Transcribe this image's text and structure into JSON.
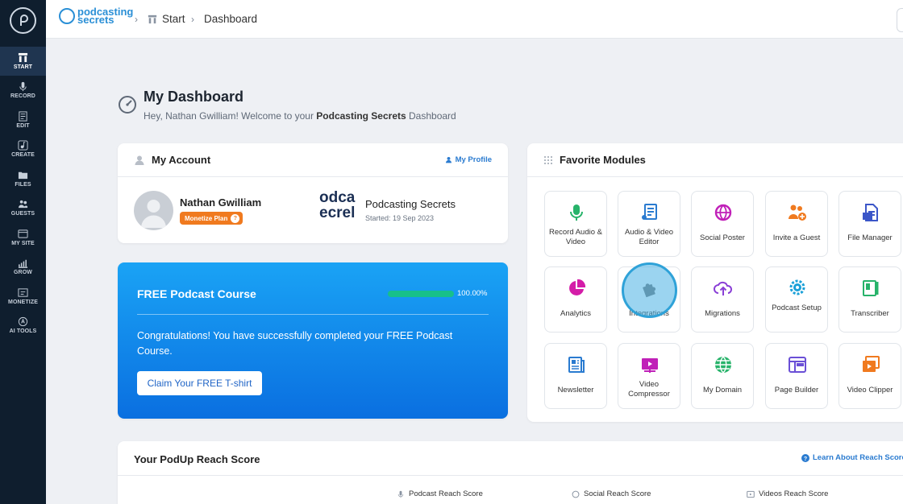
{
  "sidebar": {
    "items": [
      {
        "label": "START",
        "icon": "start-icon",
        "active": true
      },
      {
        "label": "RECORD",
        "icon": "microphone-icon"
      },
      {
        "label": "EDIT",
        "icon": "edit-icon"
      },
      {
        "label": "CREATE",
        "icon": "music-note-icon"
      },
      {
        "label": "FILES",
        "icon": "files-icon"
      },
      {
        "label": "GUESTS",
        "icon": "guests-icon"
      },
      {
        "label": "MY SITE",
        "icon": "site-icon"
      },
      {
        "label": "GROW",
        "icon": "chart-icon"
      },
      {
        "label": "MONETIZE",
        "icon": "monetize-icon"
      },
      {
        "label": "AI TOOLS",
        "icon": "ai-icon"
      }
    ]
  },
  "topbar": {
    "brand_line1": "podcasting",
    "brand_line2": "secrets",
    "breadcrumb_start": "Start",
    "breadcrumb_current": "Dashboard"
  },
  "header": {
    "title": "My Dashboard",
    "greeting_prefix": "Hey, Nathan Gwilliam! Welcome to your ",
    "greeting_brand": "Podcasting Secrets",
    "greeting_suffix": " Dashboard"
  },
  "account": {
    "title": "My Account",
    "profile_link": "My Profile",
    "name": "Nathan Gwilliam",
    "plan": "Monetize Plan",
    "plan_help": "?",
    "podcast_logo_line1": "odca",
    "podcast_logo_line2": "ecrel",
    "podcast_name": "Podcasting Secrets",
    "podcast_started": "Started: 19 Sep 2023"
  },
  "course": {
    "title": "FREE Podcast Course",
    "progress": 1.0,
    "progress_text": "100.00%",
    "message": "Congratulations! You have successfully completed your FREE Podcast Course.",
    "button": "Claim Your FREE T-shirt"
  },
  "favorites": {
    "title": "Favorite Modules",
    "modules": [
      {
        "label": "Record Audio & Video",
        "icon": "microphone-icon",
        "color": "#27b36a"
      },
      {
        "label": "Audio & Video Editor",
        "icon": "editor-icon",
        "color": "#2a7bd0"
      },
      {
        "label": "Social Poster",
        "icon": "social-globe-icon",
        "color": "#c020b8"
      },
      {
        "label": "Invite a Guest",
        "icon": "invite-guest-icon",
        "color": "#f07a1f"
      },
      {
        "label": "File Manager",
        "icon": "file-manager-icon",
        "color": "#3b56c8"
      },
      {
        "label": "Analytics",
        "icon": "pie-chart-icon",
        "color": "#d41ca8"
      },
      {
        "label": "Integrations",
        "icon": "puzzle-icon",
        "color": "#7a7a7a"
      },
      {
        "label": "Migrations",
        "icon": "cloud-upload-icon",
        "color": "#8a3fd6"
      },
      {
        "label": "Podcast Setup",
        "icon": "setup-gear-icon",
        "color": "#1aa0d8"
      },
      {
        "label": "Transcriber",
        "icon": "transcriber-icon",
        "color": "#27b36a"
      },
      {
        "label": "Newsletter",
        "icon": "newsletter-icon",
        "color": "#2a7bd0"
      },
      {
        "label": "Video Compressor",
        "icon": "video-compressor-icon",
        "color": "#c020b8"
      },
      {
        "label": "My Domain",
        "icon": "globe-icon",
        "color": "#27b36a"
      },
      {
        "label": "Page Builder",
        "icon": "page-builder-icon",
        "color": "#6a4fd6"
      },
      {
        "label": "Video Clipper",
        "icon": "video-clipper-icon",
        "color": "#f07a1f"
      }
    ]
  },
  "reach": {
    "title": "Your PodUp Reach Score",
    "learn_link": "Learn About Reach Score",
    "columns": [
      "Podcast Reach Score",
      "Social Reach Score",
      "Videos Reach Score"
    ]
  },
  "colors": {
    "sidebar_bg": "#0f1e2e",
    "accent": "#2a7bd0",
    "plan_badge": "#f07a1f",
    "progress": "#17c08a"
  }
}
